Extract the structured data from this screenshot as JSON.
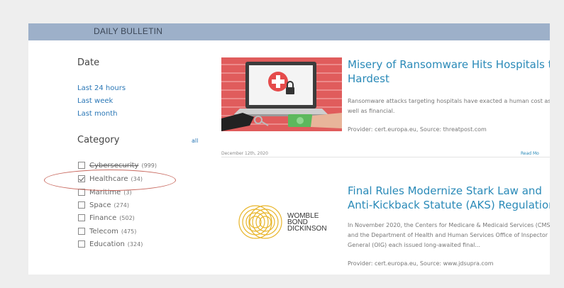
{
  "header": {
    "title": "DAILY BULLETIN"
  },
  "filters": {
    "date": {
      "title": "Date",
      "options": [
        "Last 24 hours",
        "Last week",
        "Last month"
      ]
    },
    "category": {
      "title": "Category",
      "all_label": "all",
      "items": [
        {
          "name": "Cybersecurity",
          "count": "(999)",
          "checked": false
        },
        {
          "name": "Healthcare",
          "count": "(34)",
          "checked": true
        },
        {
          "name": "Maritime",
          "count": "(3)",
          "checked": false
        },
        {
          "name": "Space",
          "count": "(274)",
          "checked": false
        },
        {
          "name": "Finance",
          "count": "(502)",
          "checked": false
        },
        {
          "name": "Telecom",
          "count": "(475)",
          "checked": false
        },
        {
          "name": "Education",
          "count": "(324)",
          "checked": false
        }
      ]
    }
  },
  "articles": [
    {
      "title_line1": "Misery of Ransomware Hits Hospitals the",
      "title_line2": "Hardest",
      "desc_line1": "Ransomware attacks targeting hospitals have exacted a human cost as",
      "desc_line2": "well as financial.",
      "provider": "Provider: cert.europa.eu,  Source: threatpost.com",
      "date": "December 12th, 2020",
      "read_more": "Read Mo"
    },
    {
      "title_line1": "Final Rules Modernize Stark Law and",
      "title_line2": "Anti-Kickback Statute (AKS) Regulations",
      "desc_line1": "In November 2020, the Centers for Medicare & Medicaid Services (CMS)",
      "desc_line2": "and the Department of Health and Human Services Office of Inspector",
      "desc_line3": "General (OIG) each issued long-awaited final...",
      "provider": "Provider: cert.europa.eu,  Source: www.jdsupra.com",
      "logo_line1": "WOMBLE",
      "logo_line2": "BOND",
      "logo_line3": "DICKINSON"
    }
  ],
  "colors": {
    "header_bar": "#9db0c9",
    "link": "#2a77b6",
    "title": "#2a8ab8",
    "annotation_oval": "#c96a60"
  }
}
